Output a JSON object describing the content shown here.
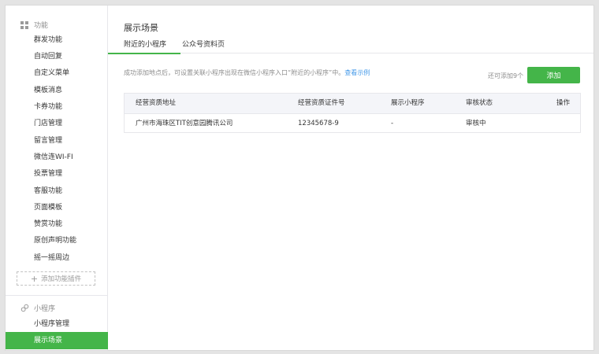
{
  "sidebar": {
    "features_header": "功能",
    "feature_items": [
      "群发功能",
      "自动回复",
      "自定义菜单",
      "模板消息",
      "卡券功能",
      "门店管理",
      "留言管理",
      "微信连WI-FI",
      "投票管理",
      "客服功能",
      "页面模板",
      "赞赏功能",
      "原创声明功能",
      "摇一摇周边"
    ],
    "add_plugin_label": "添加功能插件",
    "miniprogram_header": "小程序",
    "miniprogram_items": [
      "小程序管理"
    ],
    "active_item": "展示场景"
  },
  "main": {
    "title": "展示场景",
    "tabs": [
      {
        "label": "附近的小程序",
        "active": true
      },
      {
        "label": "公众号资料页",
        "active": false
      }
    ],
    "hint_text": "成功添加地点后，可设置关联小程序出现在微信小程序入口“附近的小程序”中。",
    "hint_link": "查看示例",
    "remaining_text": "还可添加9个",
    "add_button": "添加",
    "table": {
      "headers": [
        "经营资质地址",
        "经营资质证件号",
        "展示小程序",
        "审核状态",
        "操作"
      ],
      "rows": [
        [
          "广州市海珠区TIT创意园腾讯公司",
          "12345678-9",
          "-",
          "审核中",
          ""
        ]
      ]
    }
  },
  "colors": {
    "accent": "#44b549",
    "link": "#459ae9",
    "table_header_bg": "#f4f5f9"
  }
}
